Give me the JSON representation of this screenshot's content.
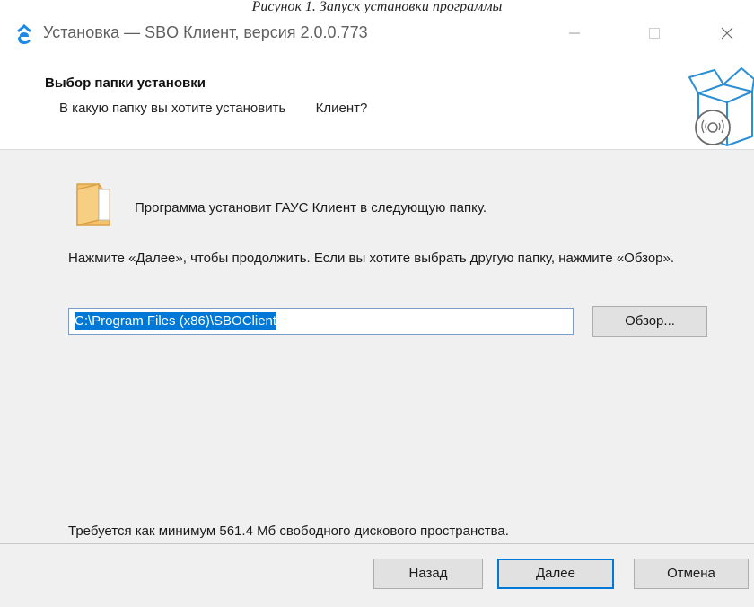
{
  "caption": "Рисунок 1. Запуск установки программы",
  "window": {
    "title": "Установка — SBO Клиент, версия 2.0.0.773",
    "controls": {
      "minimize_icon": "minimize-icon",
      "maximize_icon": "maximize-icon",
      "close_icon": "close-icon"
    }
  },
  "header": {
    "title": "Выбор папки установки",
    "subtitle": "В какую папку вы хотите установить        Клиент?"
  },
  "content": {
    "destination_text": "Программа установит ГАУС Клиент в следующую папку.",
    "instructions": "Нажмите «Далее», чтобы продолжить. Если вы хотите выбрать другую папку, нажмите «Обзор».",
    "install_path": "C:\\Program Files (x86)\\SBOClient",
    "browse_label": "Обзор...",
    "disk_space_text": "Требуется как минимум 561.4 Мб свободного дискового пространства."
  },
  "footer": {
    "back_label": "Назад",
    "next_label": "Далее",
    "cancel_label": "Отмена"
  },
  "colors": {
    "accent": "#0078d7",
    "folder": "#f5c26b",
    "content_bg": "#f0f0f0",
    "app_icon": "#1e88e5"
  }
}
